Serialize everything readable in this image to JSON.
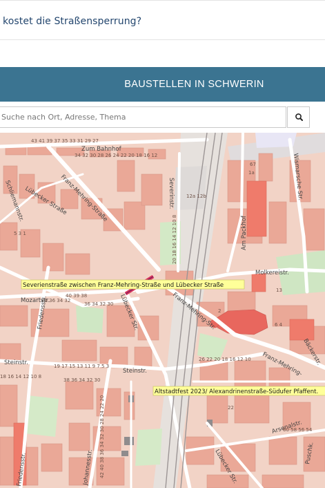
{
  "article": {
    "link_text": "kostet die Straßensperrung?"
  },
  "banner": {
    "title": "BAUSTELLEN IN SCHWERIN"
  },
  "search": {
    "placeholder": "Suche nach Ort, Adresse, Thema",
    "icon": "search-icon"
  },
  "map": {
    "streets": {
      "zum_bahnhof": "Zum Bahnhof",
      "severinstr": "Severinstr.",
      "franz_mehring_1": "Franz-Mehring-Straße",
      "franz_mehring_2": "Franz-Mehring-Str.",
      "franz_mehring_3": "Franz-Mehring-",
      "luebecker_1": "Lübecker Straße",
      "luebecker_2": "Lübecker Str.",
      "luebecker_3": "Lübecker Str.",
      "mozartstr": "Mozartstr.",
      "steinstr_1": "Steinstr.",
      "steinstr_2": "Steinstr.",
      "friedensstr_1": "Friedensstr.",
      "friedensstr_2": "Friedensstr.",
      "johannesstr": "Johannesstr.",
      "molkereistr": "Molkereistr.",
      "am_packhof": "Am Packhof",
      "wismarsche": "Wismarsche Str.",
      "arsenalstr": "Arsenalstr.",
      "schliemannstr": "Schliemannstr.",
      "baeckerstr": "Bäckerstr.",
      "puschkinstr": "Puschk."
    },
    "house_numbers": {
      "n1": "43 41 39 37 35 33 31 29 27",
      "n2": "34 32 30 28 26 24 22 20 18 16 12",
      "n3": "12a 12b",
      "n4": "20 18 16 14 12 10 8",
      "n5": "67",
      "n6": "40 39 38",
      "n7": "36 34 32 30",
      "n8": "26 22 20 18 16 12 10",
      "n9": "20 18 16 14 12 10 8 6 4 2",
      "n10": "18 16 14 12 10 8",
      "n11": "19 17 15 13 11 9 7 5 3",
      "n12": "38 36 34 32 30",
      "n13": "42 40 38 36 34 32 30 28 24 22 20",
      "n14": "40 38 36",
      "n15": "1a",
      "n16": "13",
      "n17": "6 4",
      "n18": "2",
      "n19": "60 58 56 54",
      "n20": "22",
      "n21": "74 36 34 32",
      "n22": "5 3 1"
    },
    "tooltips": [
      "Severienstraße zwischen Franz-Mehring-Straße und Lübecker Straße",
      "Altstadtfest 2023/ Alexandrinenstraße-Südufer Pfaffent."
    ],
    "colors": {
      "construction_marker": "#d9375d",
      "tooltip_bg": "#ffff99"
    }
  }
}
